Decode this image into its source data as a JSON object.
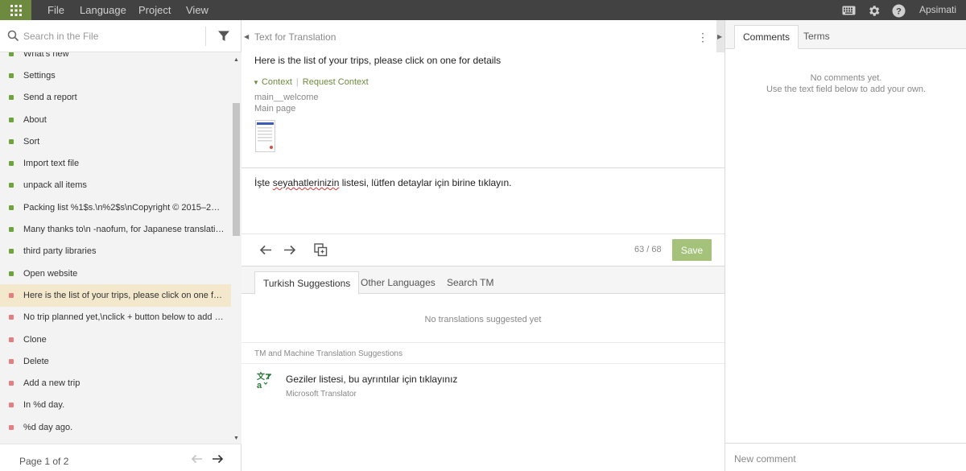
{
  "topbar": {
    "menus": [
      "File",
      "Language",
      "Project",
      "View"
    ],
    "user": "Apsimati",
    "colors": {
      "bar": "#424242",
      "accent": "#6d8a3f"
    }
  },
  "sidebar": {
    "search_placeholder": "Search in the File",
    "items": [
      {
        "label": "What's new",
        "status": "translated"
      },
      {
        "label": "Settings",
        "status": "translated"
      },
      {
        "label": "Send a report",
        "status": "translated"
      },
      {
        "label": "About",
        "status": "translated"
      },
      {
        "label": "Sort",
        "status": "translated"
      },
      {
        "label": "Import text file",
        "status": "translated"
      },
      {
        "label": "unpack all items",
        "status": "translated"
      },
      {
        "label": "Packing list %1$s.\\n%2$s\\nCopyright © 2015–2017...",
        "status": "translated"
      },
      {
        "label": "Many thanks to\\n -naofum, for Japanese translatio...",
        "status": "translated"
      },
      {
        "label": "third party libraries",
        "status": "translated"
      },
      {
        "label": "Open website",
        "status": "translated"
      },
      {
        "label": "Here is the list of your trips, please click on one for...",
        "status": "untranslated",
        "active": true
      },
      {
        "label": "No trip planned yet,\\nclick + button below to add a...",
        "status": "untranslated"
      },
      {
        "label": "Clone",
        "status": "untranslated"
      },
      {
        "label": "Delete",
        "status": "untranslated"
      },
      {
        "label": "Add a new trip",
        "status": "untranslated"
      },
      {
        "label": "In %d day.",
        "status": "untranslated"
      },
      {
        "label": "%d day ago.",
        "status": "untranslated"
      }
    ],
    "page_label": "Page 1 of 2"
  },
  "editor": {
    "source_title": "Text for Translation",
    "source_text": "Here is the list of your trips, please click on one for details",
    "context_label": "Context",
    "request_context_label": "Request Context",
    "context_key": "main__welcome",
    "context_page": "Main page",
    "translation_before": "İşte ",
    "translation_misspelled": "seyahatlerinizin",
    "translation_after": " listesi, lütfen detaylar için birine tıklayın.",
    "counter": "63 / 68",
    "save_label": "Save"
  },
  "suggestions": {
    "tabs": [
      "Turkish Suggestions",
      "Other Languages",
      "Search TM"
    ],
    "empty_text": "No translations suggested yet",
    "tm_heading": "TM and Machine Translation Suggestions",
    "mt_text": "Geziler listesi, bu ayrıntılar için tıklayınız",
    "mt_source": "Microsoft Translator"
  },
  "comments": {
    "tabs": [
      "Comments",
      "Terms"
    ],
    "empty_line1": "No comments yet.",
    "empty_line2": "Use the text field below to add your own.",
    "input_placeholder": "New comment"
  }
}
